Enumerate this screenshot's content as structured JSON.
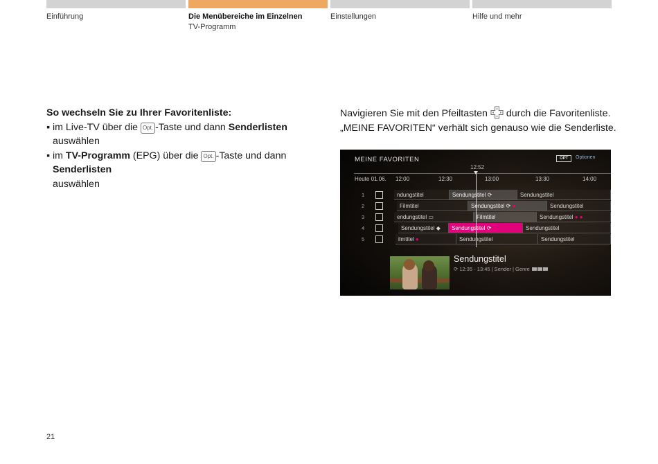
{
  "nav": {
    "tabs": [
      {
        "label": "Einführung",
        "sub": ""
      },
      {
        "label": "Die Menübereiche im Einzelnen",
        "sub": "TV-Programm"
      },
      {
        "label": "Einstellungen",
        "sub": ""
      },
      {
        "label": "Hilfe und mehr",
        "sub": ""
      }
    ],
    "active_index": 1,
    "colors": {
      "inactive": "#d3d3d3",
      "active": "#eea85f"
    }
  },
  "left": {
    "heading": "So wechseln Sie zu Ihrer Favoritenliste:",
    "bullet_char": "▪",
    "opt_key": "Opt.",
    "b1_pre": "im Live-TV über die ",
    "b1_mid": "-Taste und dann ",
    "b1_bold": "Senderlisten",
    "b1_post": " auswählen",
    "b2_pre": "im ",
    "b2_bold1": "TV-Programm",
    "b2_mid": " (EPG) über die ",
    "b2_mid2": "-Taste und dann ",
    "b2_bold2": "Senderlisten",
    "b2_post": "auswählen"
  },
  "right": {
    "line1_pre": "Navigieren Sie mit den Pfeiltasten ",
    "line1_post": " durch die Favoritenliste.",
    "line2": "„MEINE FAVORITEN“ verhält sich genauso wie die Senderliste.",
    "dpad_icon": "arrow-keys-icon"
  },
  "tv": {
    "title": "MEINE FAVORITEN",
    "opt_badge": "OPT",
    "opt_label": "Optionen",
    "now_time": "12:52",
    "day": "Heute 01.06.",
    "times": [
      "12:00",
      "12:30",
      "13:00",
      "13:30",
      "14:00"
    ],
    "rows": [
      {
        "num": "1",
        "cells": [
          "ndungstitel",
          "Sendungstitel ⟳",
          "Sendungstitel"
        ]
      },
      {
        "num": "2",
        "cells": [
          "Filmtitel",
          "Sendungstitel ⟳",
          "●",
          "Sendungstitel"
        ]
      },
      {
        "num": "3",
        "cells": [
          "endungstitel ▭",
          "Filmtitel",
          "Sendungstitel",
          "● ●"
        ]
      },
      {
        "num": "4",
        "cells": [
          "Sendungstitel ◆",
          "Sendungstitel ⟳",
          "Sendungstitel"
        ]
      },
      {
        "num": "5",
        "cells": [
          "ilmtitel",
          "●",
          "Sendungstitel",
          "Sendungstitel"
        ]
      }
    ],
    "program_title": "Sendungstitel",
    "program_meta": "⟳ 12:35 - 13:45  |  Sender  |  Genre",
    "highlight_color": "#e2007a"
  },
  "page_number": "21"
}
